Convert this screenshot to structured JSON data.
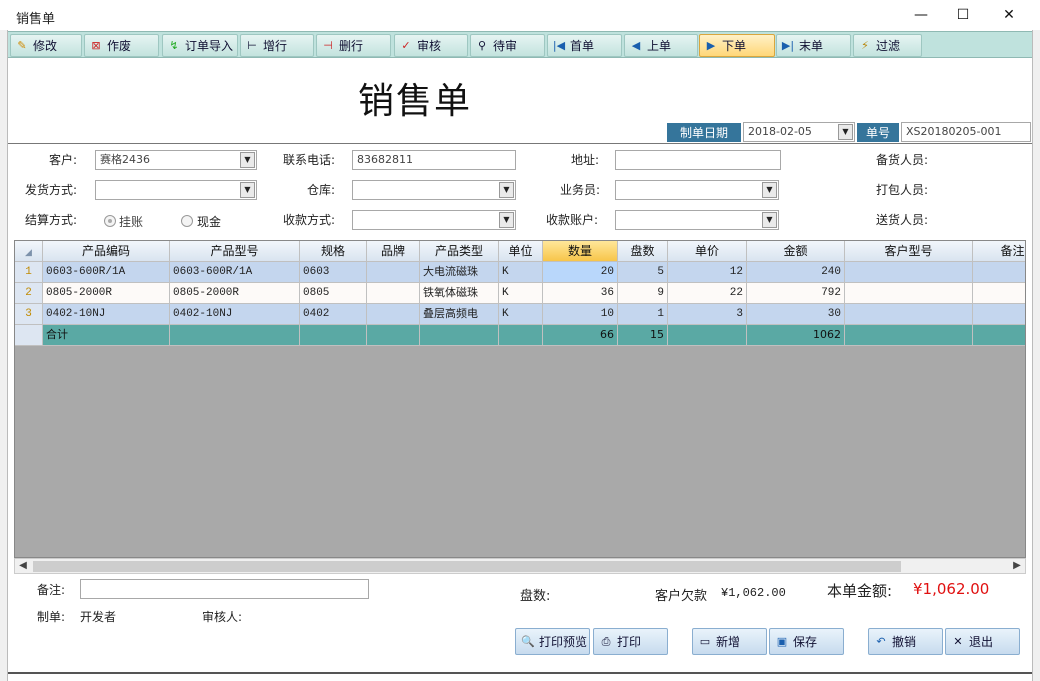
{
  "window": {
    "title": "销售单",
    "minimize": "—",
    "maximize": "☐",
    "close": "✕"
  },
  "toolbar": {
    "edit": "修改",
    "void": "作废",
    "import_order": "订单导入",
    "add_row": "增行",
    "delete_row": "删行",
    "audit": "审核",
    "pending": "待审",
    "first": "首单",
    "prev": "上单",
    "next": "下单",
    "last": "末单",
    "filter": "过滤"
  },
  "form": {
    "title": "销售单",
    "date_label": "制单日期",
    "date_value": "2018-02-05",
    "order_no_label": "单号",
    "order_no_value": "XS20180205-001"
  },
  "fields": {
    "customer_label": "客户:",
    "customer_value": "赛格2436",
    "phone_label": "联系电话:",
    "phone_value": "83682811",
    "address_label": "地址:",
    "address_value": "",
    "stock_staff_label": "备货人员:",
    "ship_method_label": "发货方式:",
    "ship_method_value": "",
    "warehouse_label": "仓库:",
    "warehouse_value": "",
    "salesman_label": "业务员:",
    "salesman_value": "",
    "pack_staff_label": "打包人员:",
    "settle_label": "结算方式:",
    "settle_opt1": "挂账",
    "settle_opt2": "现金",
    "collect_method_label": "收款方式:",
    "collect_method_value": "",
    "collect_account_label": "收款账户:",
    "collect_account_value": "",
    "delivery_staff_label": "送货人员:"
  },
  "grid": {
    "columns": [
      "产品编码",
      "产品型号",
      "规格",
      "品牌",
      "产品类型",
      "单位",
      "数量",
      "盘数",
      "单价",
      "金额",
      "客户型号",
      "备注"
    ],
    "rows": [
      [
        "1",
        "0603-600R/1A",
        "0603-600R/1A",
        "0603",
        "",
        "大电流磁珠",
        "K",
        "20",
        "5",
        "12",
        "240",
        "",
        ""
      ],
      [
        "2",
        "0805-2000R",
        "0805-2000R",
        "0805",
        "",
        "铁氧体磁珠",
        "K",
        "36",
        "9",
        "22",
        "792",
        "",
        ""
      ],
      [
        "3",
        "0402-10NJ",
        "0402-10NJ",
        "0402",
        "",
        "叠层高频电",
        "K",
        "10",
        "1",
        "3",
        "30",
        "",
        ""
      ]
    ],
    "total": [
      "",
      "合计",
      "",
      "",
      "",
      "",
      "",
      "66",
      "15",
      "",
      "1062",
      "",
      ""
    ]
  },
  "footer": {
    "remark_label": "备注:",
    "remark_value": "",
    "maker_label": "制单:",
    "maker_value": "开发者",
    "auditor_label": "审核人:",
    "reels_label": "盘数:",
    "owed_label": "客户欠款",
    "owed_value": "¥1,062.00",
    "amount_label": "本单金额:",
    "amount_value": "¥1,062.00"
  },
  "buttons": {
    "print_preview": "打印预览",
    "print": "打印",
    "new": "新增",
    "save": "保存",
    "cancel": "撤销",
    "exit": "退出"
  },
  "colors": {
    "toolbar": "#bfe2dd",
    "header_label": "#35759b",
    "row_even": "#c4d6ee",
    "row_odd": "#fdfaf8",
    "total_row": "#5aa9a4",
    "amount_red": "#e01010"
  }
}
